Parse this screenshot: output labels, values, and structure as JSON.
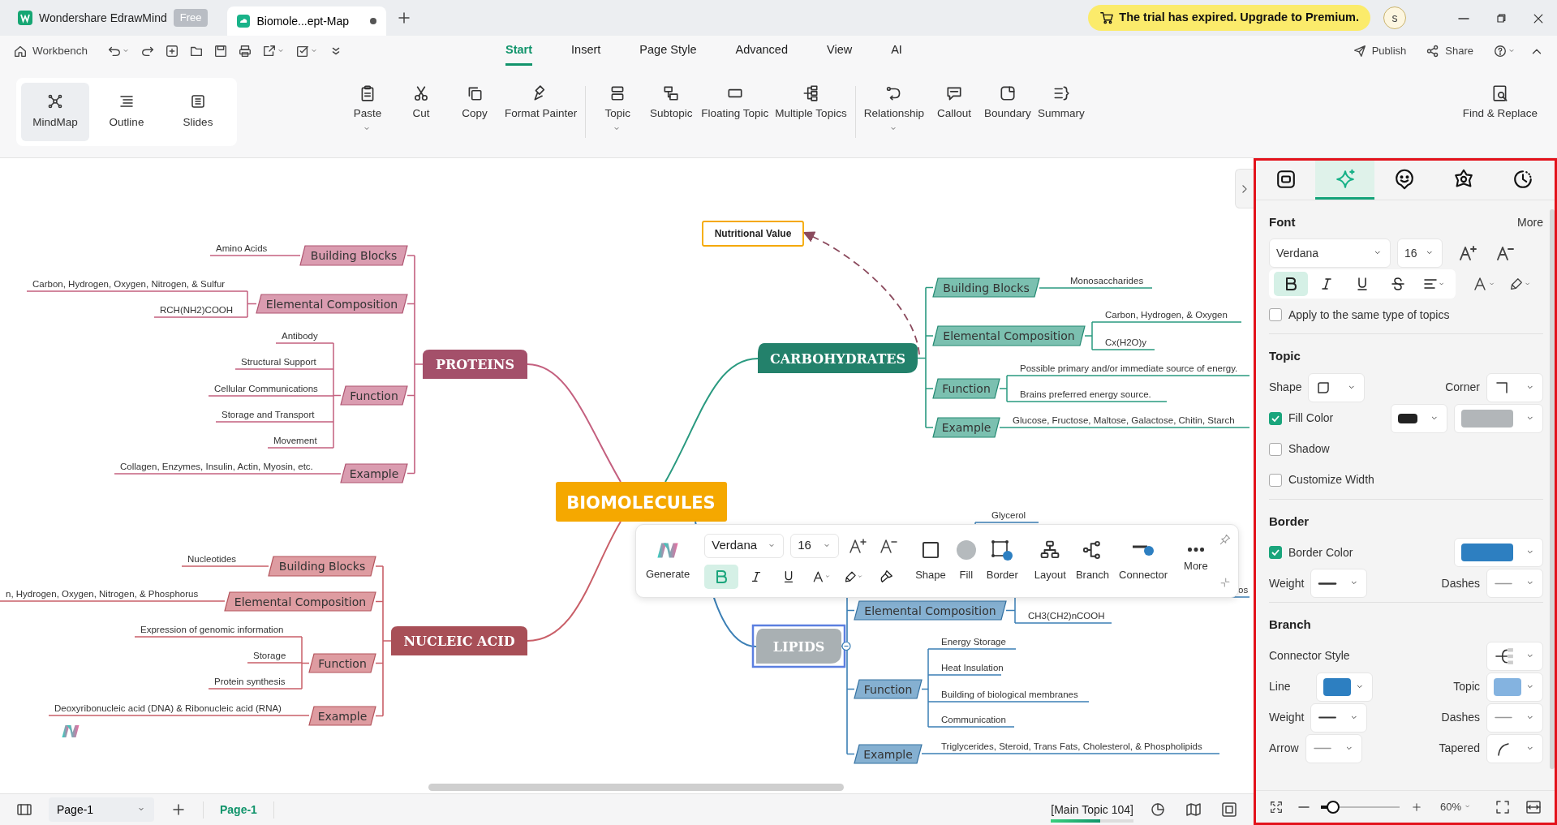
{
  "title_bar": {
    "app_tab": "Wondershare EdrawMind",
    "plan_badge": "Free",
    "doc_tab": {
      "title": "Biomole...ept-Map",
      "unsaved": true
    },
    "trial_banner": "The trial has expired. Upgrade to Premium.",
    "avatar": "s"
  },
  "menu_bar": {
    "workbench": "Workbench",
    "tabs": [
      {
        "label": "Start",
        "selected": true
      },
      {
        "label": "Insert",
        "selected": false
      },
      {
        "label": "Page Style",
        "selected": false
      },
      {
        "label": "Advanced",
        "selected": false
      },
      {
        "label": "View",
        "selected": false
      },
      {
        "label": "AI",
        "selected": false
      }
    ],
    "publish": "Publish",
    "share": "Share"
  },
  "ribbon": {
    "views": [
      {
        "label": "MindMap",
        "selected": true
      },
      {
        "label": "Outline",
        "selected": false
      },
      {
        "label": "Slides",
        "selected": false
      }
    ],
    "groups": [
      [
        {
          "label": "Paste",
          "dropdown": true
        },
        {
          "label": "Cut",
          "dropdown": false
        },
        {
          "label": "Copy",
          "dropdown": false
        },
        {
          "label": "Format Painter",
          "dropdown": false
        }
      ],
      [
        {
          "label": "Topic",
          "dropdown": true
        },
        {
          "label": "Subtopic",
          "dropdown": false
        },
        {
          "label": "Floating Topic",
          "dropdown": false
        },
        {
          "label": "Multiple Topics",
          "dropdown": false
        }
      ],
      [
        {
          "label": "Relationship",
          "dropdown": true
        },
        {
          "label": "Callout",
          "dropdown": false
        },
        {
          "label": "Boundary",
          "dropdown": false
        },
        {
          "label": "Summary",
          "dropdown": false
        }
      ]
    ],
    "find_replace": "Find & Replace"
  },
  "mind_map": {
    "central": {
      "label": "BIOMOLECULES",
      "color": "#f5a800"
    },
    "branches": [
      {
        "label": "PROTEINS",
        "color": "#c4607f",
        "selected": false,
        "subtopics": [
          {
            "label": "Building Blocks",
            "leaves": [
              "Amino Acids"
            ]
          },
          {
            "label": "Elemental Composition",
            "leaves": [
              "Carbon, Hydrogen, Oxygen, Nitrogen, & Sulfur",
              "RCH(NH2)COOH"
            ]
          },
          {
            "label": "Function",
            "leaves": [
              "Antibody",
              "Structural Support",
              "Cellular Communications",
              "Storage and Transport",
              "Movement"
            ]
          },
          {
            "label": "Example",
            "leaves": [
              "Collagen, Enzymes, Insulin, Actin, Myosin, etc."
            ]
          }
        ]
      },
      {
        "label": "NUCLEIC ACID",
        "color": "#c95f68",
        "selected": false,
        "subtopics": [
          {
            "label": "Building Blocks",
            "leaves": [
              "Nucleotides"
            ]
          },
          {
            "label": "Elemental Composition",
            "leaves": [
              "n, Hydrogen, Oxygen, Nitrogen, & Phosphorus"
            ]
          },
          {
            "label": "Function",
            "leaves": [
              "Expression of genomic information",
              "Storage",
              "Protein synthesis"
            ]
          },
          {
            "label": "Example",
            "leaves": [
              "Deoxyribonucleic acid (DNA) & Ribonucleic acid (RNA)"
            ]
          }
        ]
      },
      {
        "label": "CARBOHYDRATES",
        "color": "#2a9a80",
        "selected": false,
        "subtopics": [
          {
            "label": "Building Blocks",
            "leaves": [
              "Monosaccharides"
            ]
          },
          {
            "label": "Elemental Composition",
            "leaves": [
              "Carbon, Hydrogen, & Oxygen",
              "Cx(H2O)y"
            ]
          },
          {
            "label": "Function",
            "leaves": [
              "Possible primary  and/or immediate  source of energy.",
              "Brains preferred energy source."
            ]
          },
          {
            "label": "Example",
            "leaves": [
              "Glucose, Fructose, Maltose, Galactose, Chitin, Starch"
            ]
          }
        ]
      },
      {
        "label": "LIPIDS",
        "color": "#3b7fb5",
        "selected": true,
        "subtopics": [
          {
            "leaves": [
              "Glycerol"
            ]
          },
          {
            "label": "Elemental Composition",
            "leaves": [
              "os",
              "CH3(CH2)nCOOH"
            ]
          },
          {
            "label": "Function",
            "leaves": [
              "Energy Storage",
              "Heat Insulation",
              "Building of biological membranes",
              "Communication"
            ]
          },
          {
            "label": "Example",
            "leaves": [
              "Triglycerides, Steroid, Trans Fats, Cholesterol, & Phospholipids"
            ]
          }
        ]
      }
    ],
    "floating_topic": "Nutritional Value"
  },
  "floating_toolbar": {
    "generate": "Generate",
    "font": "Verdana",
    "size": "16",
    "bold": true,
    "tools": [
      "Shape",
      "Fill",
      "Border",
      "Layout",
      "Branch",
      "Connector",
      "More"
    ]
  },
  "format_panel": {
    "tabs": [
      {
        "selected": false
      },
      {
        "selected": true
      },
      {
        "selected": false
      },
      {
        "selected": false
      },
      {
        "selected": false
      }
    ],
    "font": {
      "title": "Font",
      "more": "More",
      "family": "Verdana",
      "size": "16",
      "bold": true,
      "apply": {
        "label": "Apply to the same type of topics",
        "checked": false
      }
    },
    "topic": {
      "title": "Topic",
      "shape": "Shape",
      "corner": "Corner",
      "fill": {
        "label": "Fill Color",
        "checked": true
      },
      "shadow": {
        "label": "Shadow",
        "checked": false
      },
      "width": {
        "label": "Customize Width",
        "checked": false
      }
    },
    "border": {
      "title": "Border",
      "color": {
        "label": "Border Color",
        "checked": true
      },
      "weight": "Weight",
      "dashes": "Dashes"
    },
    "branch": {
      "title": "Branch",
      "connector_style": "Connector Style",
      "line": "Line",
      "topic": "Topic",
      "weight": "Weight",
      "dashes": "Dashes",
      "arrow": "Arrow",
      "tapered": "Tapered"
    },
    "zoom": {
      "level": 0.15,
      "reading": "60%"
    }
  },
  "status_bar": {
    "page_select": "Page-1",
    "pages": [
      {
        "label": "Page-1",
        "selected": true
      }
    ],
    "selection": "[Main Topic 104]",
    "level": 0.6
  }
}
